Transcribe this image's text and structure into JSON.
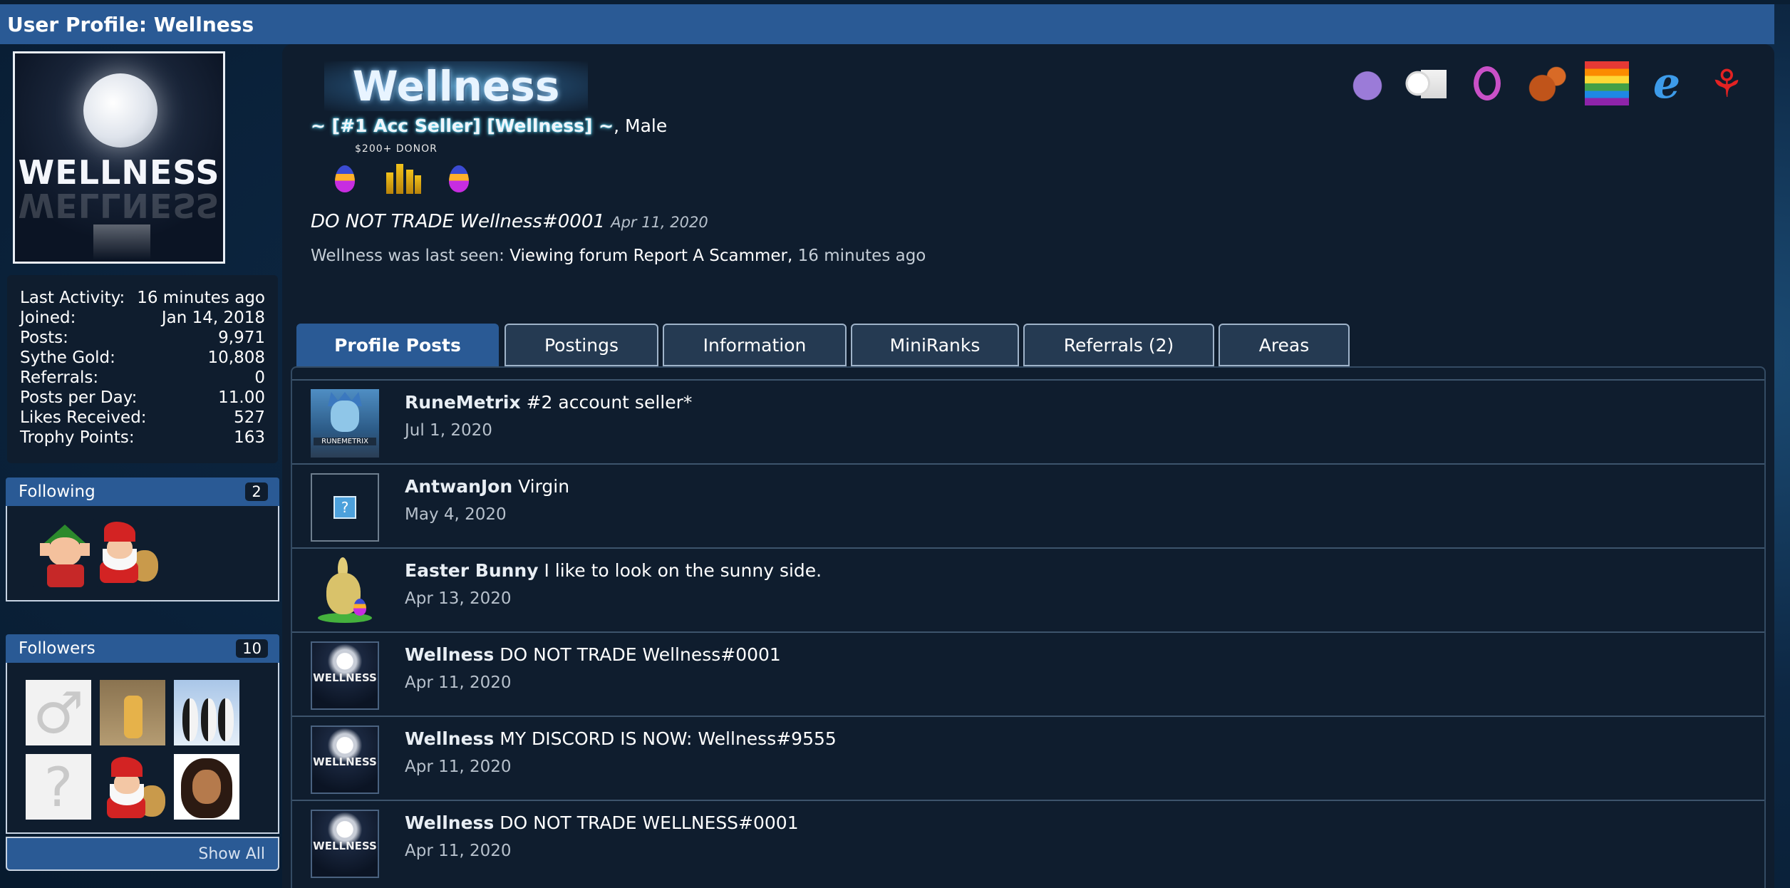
{
  "page": {
    "title": "User Profile: Wellness"
  },
  "avatar": {
    "text": "WELLNESS"
  },
  "stats": [
    {
      "label": "Last Activity:",
      "value": "16 minutes ago"
    },
    {
      "label": "Joined:",
      "value": "Jan 14, 2018"
    },
    {
      "label": "Posts:",
      "value": "9,971"
    },
    {
      "label": "Sythe Gold:",
      "value": "10,808"
    },
    {
      "label": "Referrals:",
      "value": "0"
    },
    {
      "label": "Posts per Day:",
      "value": "11.00"
    },
    {
      "label": "Likes Received:",
      "value": "527"
    },
    {
      "label": "Trophy Points:",
      "value": "163"
    }
  ],
  "following": {
    "label": "Following",
    "count": "2"
  },
  "followers": {
    "label": "Followers",
    "count": "10",
    "show_all": "Show All"
  },
  "profile": {
    "banner_name": "Wellness",
    "custom_title": "~ [#1 Acc Seller] [Wellness] ~",
    "gender": ", Male",
    "donor_label": "$200+ DONOR",
    "status_text": "DO NOT TRADE Wellness#0001",
    "status_date": "Apr 11, 2020",
    "last_seen_prefix": "Wellness was last seen:",
    "last_seen_action": "Viewing forum",
    "last_seen_place": "Report A Scammer,",
    "last_seen_time": "16 minutes ago"
  },
  "tabs": [
    {
      "label": "Profile Posts",
      "active": true
    },
    {
      "label": "Postings"
    },
    {
      "label": "Information"
    },
    {
      "label": "MiniRanks"
    },
    {
      "label": "Referrals (2)"
    },
    {
      "label": "Areas"
    }
  ],
  "posts": [
    {
      "user": "RuneMetrix",
      "text": "#2 account seller*",
      "date": "Jul 1, 2020",
      "avatar_text": "RUNEMETRIX"
    },
    {
      "user": "AntwanJon",
      "text": "Virgin",
      "date": "May 4, 2020",
      "avatar_text": "?"
    },
    {
      "user": "Easter Bunny",
      "text": "I like to look on the sunny side.",
      "date": "Apr 13, 2020"
    },
    {
      "user": "Wellness",
      "text": "DO NOT TRADE Wellness#0001",
      "date": "Apr 11, 2020",
      "avatar_text": "WELLNESS"
    },
    {
      "user": "Wellness",
      "text": "MY DISCORD IS NOW: Wellness#9555",
      "date": "Apr 11, 2020",
      "avatar_text": "WELLNESS"
    },
    {
      "user": "Wellness",
      "text": "DO NOT TRADE WELLNESS#0001",
      "date": "Apr 11, 2020",
      "avatar_text": "WELLNESS"
    }
  ],
  "badge_icons": [
    "unicorn-icon",
    "toilet-paper-icon",
    "pink-ring-icon",
    "squirrel-icon",
    "rainbow-flag-icon",
    "internet-explorer-icon",
    "red-ribbon-icon"
  ],
  "colors": {
    "header_blue": "#2a5a95",
    "panel_dark": "#0f1d2e",
    "accent_cyan": "#5fe1ff"
  }
}
